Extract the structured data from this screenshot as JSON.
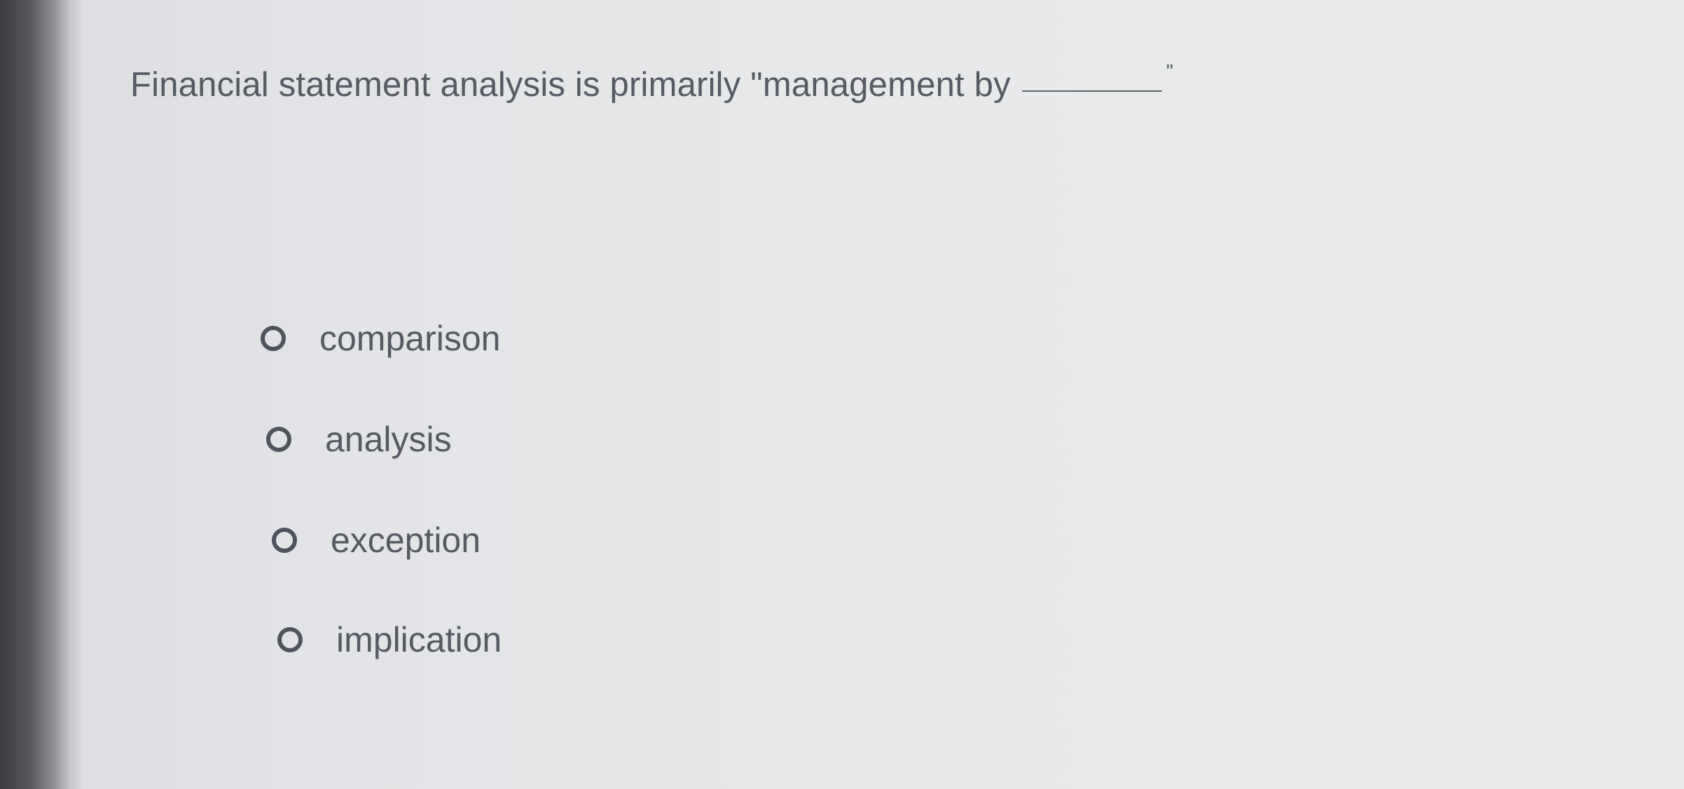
{
  "question": {
    "text": "Financial statement analysis is primarily \"management by",
    "closing": "\""
  },
  "options": [
    {
      "label": "comparison",
      "selected": false
    },
    {
      "label": "analysis",
      "selected": false
    },
    {
      "label": "exception",
      "selected": false
    },
    {
      "label": "implication",
      "selected": false
    }
  ],
  "colors": {
    "text": "#555a63",
    "radio_border": "#4f545c",
    "background": "#e8e9ea"
  }
}
